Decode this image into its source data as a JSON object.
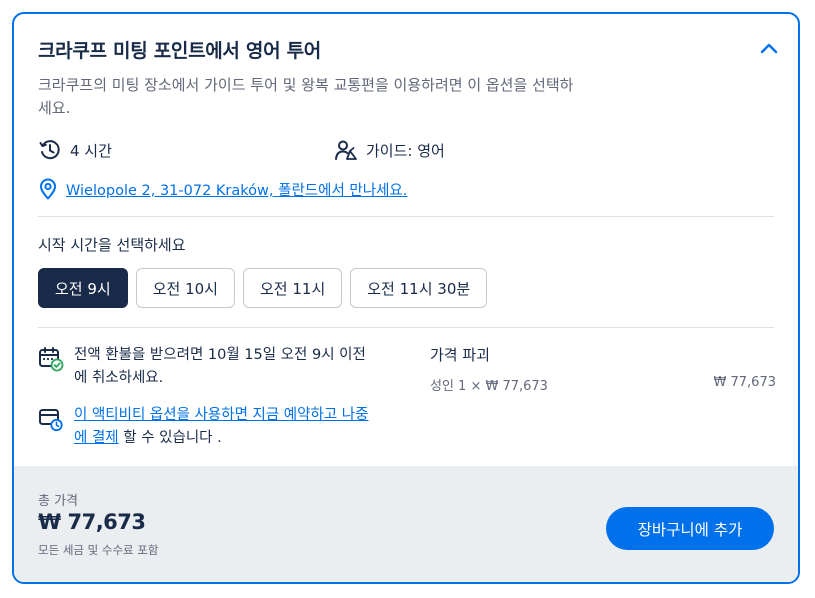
{
  "option": {
    "title": "크라쿠프 미팅 포인트에서 영어 투어",
    "description": "크라쿠프의 미팅 장소에서 가이드 투어 및 왕복 교통편을 이용하려면 이 옵션을 선택하세요.",
    "duration": "4 시간",
    "guide": "가이드: 영어",
    "location_link": "Wielopole 2, 31-072 Kraków, 폴란드에서 만나세요."
  },
  "times": {
    "label": "시작 시간을 선택하세요",
    "slots": [
      "오전 9시",
      "오전 10시",
      "오전 11시",
      "오전 11시 30분"
    ],
    "selected": "오전 9시"
  },
  "policy": {
    "refund_text": "전액 환불을 받으려면 10월 15일 오전 9시 이전에 취소하세요.",
    "reserve_link": "이 액티비티 옵션을 사용하면 지금 예약하고 나중에 결제",
    "reserve_suffix": " 할 수 있습니다 ."
  },
  "price_breakdown": {
    "title": "가격 파괴",
    "line_label": "성인 1 × ₩ 77,673",
    "line_value": "₩ 77,673"
  },
  "footer": {
    "total_label": "총 가격",
    "total_price": "₩ 77,673",
    "tax_note": "모든 세금 및 수수료 포함",
    "cart_button": "장바구니에 추가"
  },
  "colors": {
    "accent": "#0071eb",
    "dark": "#1a2b49",
    "muted": "#63687a",
    "footer_bg": "#ebeef1",
    "success": "#2da45a"
  }
}
